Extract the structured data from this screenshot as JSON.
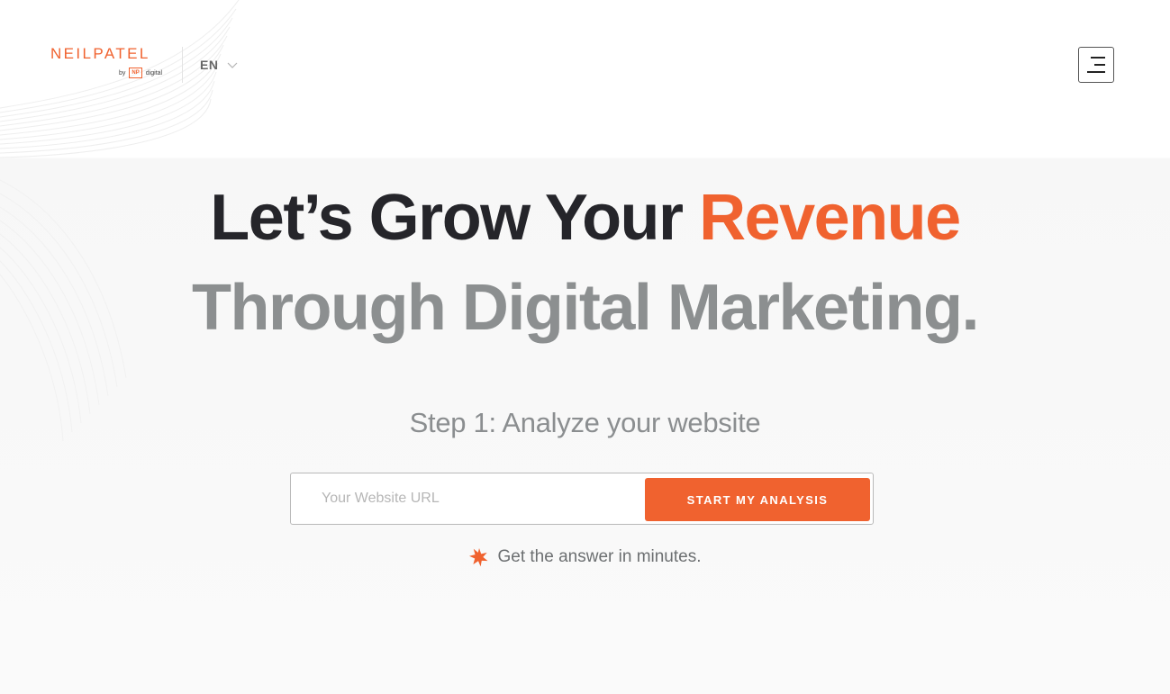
{
  "header": {
    "logo": {
      "wordmark": "NEILPATEL",
      "by_text": "by",
      "np_badge": "NP",
      "digital_text": "digital"
    },
    "language": {
      "selected": "EN",
      "icon": "chevron-down-icon"
    },
    "menu": {
      "icon": "hamburger-menu-icon"
    }
  },
  "hero": {
    "headline": {
      "line1_lead": "Let’s Grow Your ",
      "line1_accent": "Revenue",
      "line2": "Through Digital Marketing."
    },
    "step_text": "Step 1: Analyze your website",
    "form": {
      "url_placeholder": "Your Website URL",
      "url_value": "",
      "submit_label": "START MY ANALYSIS"
    },
    "note": {
      "icon": "star-burst-icon",
      "text": "Get the answer in minutes."
    }
  },
  "colors": {
    "accent": "#f0622f",
    "heading_dark": "#25252a",
    "heading_gray": "#8c8f90",
    "body_gray": "#6c6f71"
  }
}
